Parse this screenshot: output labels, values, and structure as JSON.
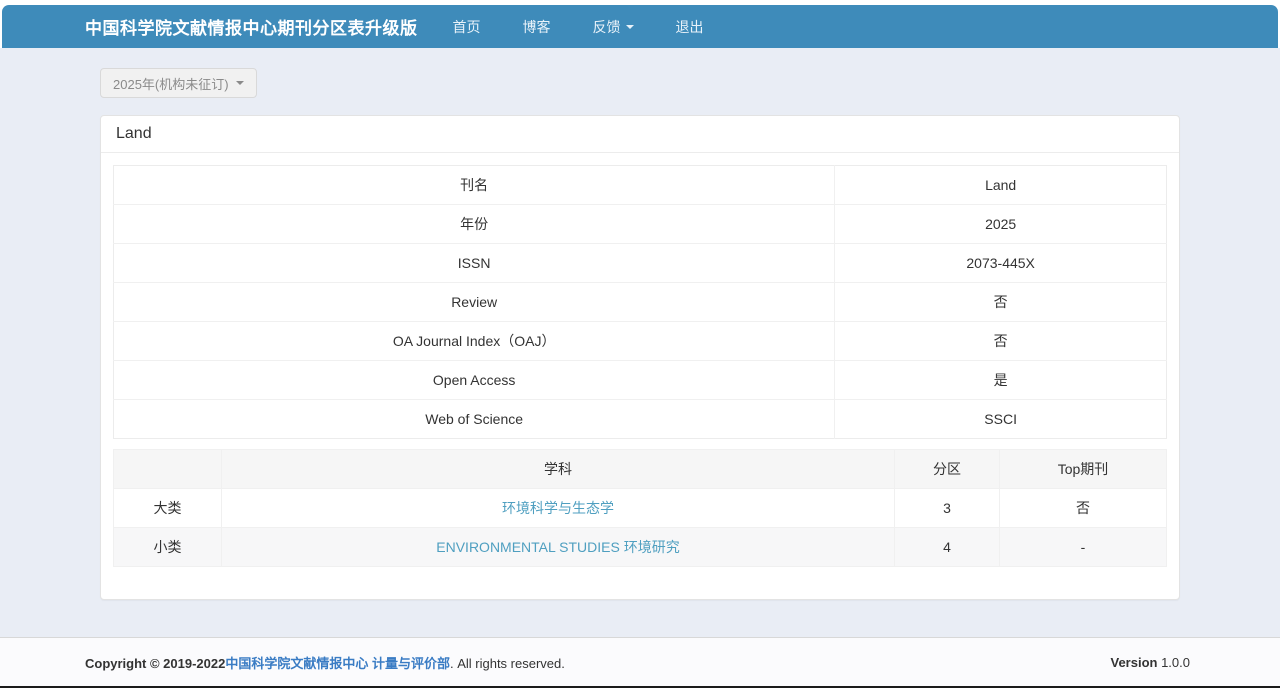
{
  "navbar": {
    "brand": "中国科学院文献情报中心期刊分区表升级版",
    "items": [
      {
        "label": "首页"
      },
      {
        "label": "博客"
      },
      {
        "label": "反馈"
      },
      {
        "label": "退出"
      }
    ]
  },
  "year_selector": {
    "label": "2025年(机构未征订)"
  },
  "panel": {
    "title": "Land",
    "info_table": {
      "rows": [
        {
          "label": "刊名",
          "value": "Land"
        },
        {
          "label": "年份",
          "value": "2025"
        },
        {
          "label": "ISSN",
          "value": "2073-445X"
        },
        {
          "label": "Review",
          "value": "否"
        },
        {
          "label": "OA Journal Index（OAJ）",
          "value": "否"
        },
        {
          "label": "Open Access",
          "value": "是"
        },
        {
          "label": "Web of Science",
          "value": "SSCI"
        }
      ]
    },
    "category_table": {
      "headers": [
        "",
        "学科",
        "分区",
        "Top期刊"
      ],
      "rows": [
        {
          "type": "大类",
          "subject": "环境科学与生态学",
          "partition": "3",
          "top": "否"
        },
        {
          "type": "小类",
          "subject": "ENVIRONMENTAL STUDIES 环境研究",
          "partition": "4",
          "top": "-"
        }
      ]
    }
  },
  "footer": {
    "copyright_prefix": "Copyright © 2019-2022",
    "copyright_link": "中国科学院文献情报中心 计量与评价部",
    "copyright_suffix": ". All rights reserved.",
    "version_label": "Version",
    "version_value": "1.0.0"
  },
  "colors": {
    "navbar_bg": "#3e8bba",
    "body_bg": "#e9edf5",
    "table_link": "#4f9fc0",
    "footer_link": "#3a7cc4"
  }
}
